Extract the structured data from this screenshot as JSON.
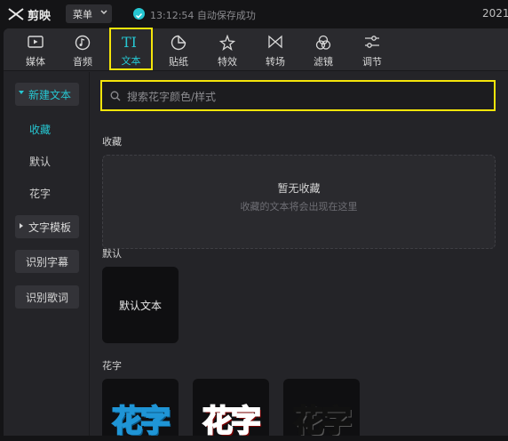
{
  "titlebar": {
    "app_name": "剪映",
    "menu_label": "菜单",
    "save_status": "13:12:54 自动保存成功",
    "year": "2021"
  },
  "toolbar": {
    "tabs": [
      {
        "label": "媒体",
        "icon": "media-icon"
      },
      {
        "label": "音频",
        "icon": "audio-icon"
      },
      {
        "label": "文本",
        "icon": "text-icon",
        "active": true
      },
      {
        "label": "贴纸",
        "icon": "sticker-icon"
      },
      {
        "label": "特效",
        "icon": "effects-icon"
      },
      {
        "label": "转场",
        "icon": "transition-icon"
      },
      {
        "label": "滤镜",
        "icon": "filter-icon"
      },
      {
        "label": "调节",
        "icon": "adjust-icon"
      }
    ]
  },
  "sidebar": {
    "new_text": "新建文本",
    "favorites": "收藏",
    "default": "默认",
    "fancy": "花字",
    "templates": "文字模板",
    "subtitles": "识别字幕",
    "lyrics": "识别歌词"
  },
  "search": {
    "placeholder": "搜索花字颜色/样式"
  },
  "content": {
    "favorites_title": "收藏",
    "empty_title": "暂无收藏",
    "empty_sub": "收藏的文本将会出现在这里",
    "default_title": "默认",
    "default_card": "默认文本",
    "fancy_title": "花字",
    "fancy_cards": [
      "花字",
      "花字",
      "花字"
    ]
  },
  "colors": {
    "accent": "#26c7d2",
    "highlight": "#f5e50a"
  }
}
